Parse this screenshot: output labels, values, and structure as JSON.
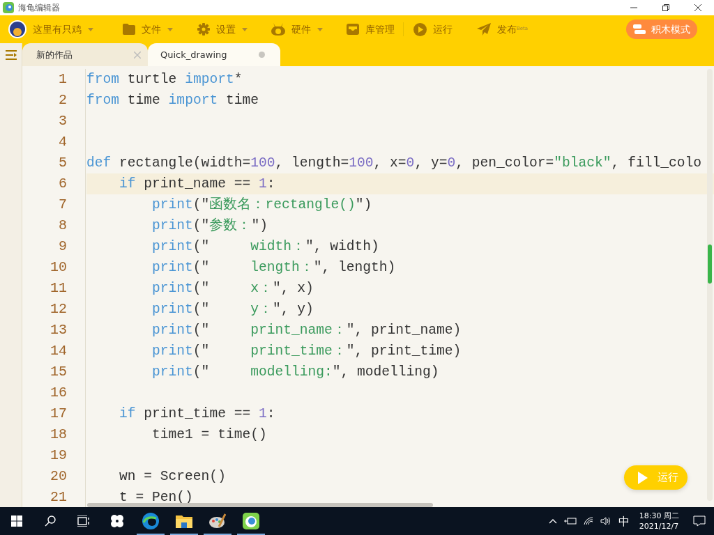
{
  "window": {
    "title": "海龟编辑器"
  },
  "toolbar": {
    "user": "这里有只鸡",
    "menus": [
      {
        "label": "文件",
        "dropdown": true
      },
      {
        "label": "设置",
        "dropdown": true
      },
      {
        "label": "硬件",
        "dropdown": true
      },
      {
        "label": "库管理",
        "dropdown": false
      },
      {
        "label": "运行",
        "dropdown": false
      },
      {
        "label": "发布$^{Beta}$",
        "dropdown": false
      }
    ],
    "mode_button": "积木模式"
  },
  "tabs": [
    {
      "label": "新的作品",
      "selected": false,
      "modified": false
    },
    {
      "label": "Quick_drawing",
      "selected": true,
      "modified": true
    }
  ],
  "editor": {
    "lines": [
      {
        "number": "1",
        "current": false,
        "tokens": [
          {
            "kind": "kw",
            "text": "from"
          },
          {
            "kind": "plain",
            "text": " turtle "
          },
          {
            "kind": "kw",
            "text": "import"
          },
          {
            "kind": "plain",
            "text": "*"
          }
        ]
      },
      {
        "number": "2",
        "current": false,
        "tokens": [
          {
            "kind": "kw",
            "text": "from"
          },
          {
            "kind": "plain",
            "text": " time "
          },
          {
            "kind": "kw",
            "text": "import"
          },
          {
            "kind": "plain",
            "text": " time"
          }
        ]
      },
      {
        "number": "3",
        "current": false
      },
      {
        "number": "4",
        "current": false
      },
      {
        "number": "5",
        "current": false,
        "tokens": [
          {
            "kind": "kw",
            "text": "def"
          },
          {
            "kind": "plain",
            "text": " rectangle(width="
          },
          {
            "kind": "num",
            "text": "100"
          },
          {
            "kind": "plain",
            "text": ", length="
          },
          {
            "kind": "num",
            "text": "100"
          },
          {
            "kind": "plain",
            "text": ", x="
          },
          {
            "kind": "num",
            "text": "0"
          },
          {
            "kind": "plain",
            "text": ", y="
          },
          {
            "kind": "num",
            "text": "0"
          },
          {
            "kind": "plain",
            "text": ", pen_color="
          },
          {
            "kind": "str",
            "text": "\"black\""
          },
          {
            "kind": "plain",
            "text": ", fill_colo"
          }
        ]
      },
      {
        "number": "6",
        "current": true,
        "tokens": [
          {
            "kind": "kw",
            "text": "    if"
          },
          {
            "kind": "plain",
            "text": " print_name == "
          },
          {
            "kind": "num",
            "text": "1"
          },
          {
            "kind": "plain",
            "text": ":"
          }
        ]
      },
      {
        "number": "7",
        "current": false,
        "tokens": [
          {
            "kind": "builtin",
            "text": "        print"
          },
          {
            "kind": "plain",
            "text": "(\""
          },
          {
            "kind": "str",
            "text": "函数名：rectangle()"
          },
          {
            "kind": "plain",
            "text": "\")"
          }
        ]
      },
      {
        "number": "8",
        "current": false,
        "tokens": [
          {
            "kind": "builtin",
            "text": "        print"
          },
          {
            "kind": "plain",
            "text": "(\""
          },
          {
            "kind": "str",
            "text": "参数："
          },
          {
            "kind": "plain",
            "text": "\")"
          }
        ]
      },
      {
        "number": "9",
        "current": false,
        "tokens": [
          {
            "kind": "builtin",
            "text": "        print"
          },
          {
            "kind": "plain",
            "text": "(\"     "
          },
          {
            "kind": "str",
            "text": "width："
          },
          {
            "kind": "plain",
            "text": "\", width)"
          }
        ]
      },
      {
        "number": "10",
        "current": false,
        "tokens": [
          {
            "kind": "builtin",
            "text": "        print"
          },
          {
            "kind": "plain",
            "text": "(\"     "
          },
          {
            "kind": "str",
            "text": "length："
          },
          {
            "kind": "plain",
            "text": "\", length)"
          }
        ]
      },
      {
        "number": "11",
        "current": false,
        "tokens": [
          {
            "kind": "builtin",
            "text": "        print"
          },
          {
            "kind": "plain",
            "text": "(\"     "
          },
          {
            "kind": "str",
            "text": "x："
          },
          {
            "kind": "plain",
            "text": "\", x)"
          }
        ]
      },
      {
        "number": "12",
        "current": false,
        "tokens": [
          {
            "kind": "builtin",
            "text": "        print"
          },
          {
            "kind": "plain",
            "text": "(\"     "
          },
          {
            "kind": "str",
            "text": "y："
          },
          {
            "kind": "plain",
            "text": "\", y)"
          }
        ]
      },
      {
        "number": "13",
        "current": false,
        "tokens": [
          {
            "kind": "builtin",
            "text": "        print"
          },
          {
            "kind": "plain",
            "text": "(\"     "
          },
          {
            "kind": "str",
            "text": "print_name："
          },
          {
            "kind": "plain",
            "text": "\", print_name)"
          }
        ]
      },
      {
        "number": "14",
        "current": false,
        "tokens": [
          {
            "kind": "builtin",
            "text": "        print"
          },
          {
            "kind": "plain",
            "text": "(\"     "
          },
          {
            "kind": "str",
            "text": "print_time："
          },
          {
            "kind": "plain",
            "text": "\", print_time)"
          }
        ]
      },
      {
        "number": "15",
        "current": false,
        "tokens": [
          {
            "kind": "builtin",
            "text": "        print"
          },
          {
            "kind": "plain",
            "text": "(\"     "
          },
          {
            "kind": "str",
            "text": "modelling:"
          },
          {
            "kind": "plain",
            "text": "\", modelling)"
          }
        ]
      },
      {
        "number": "16",
        "current": false
      },
      {
        "number": "17",
        "current": false,
        "tokens": [
          {
            "kind": "kw",
            "text": "    if"
          },
          {
            "kind": "plain",
            "text": " print_time == "
          },
          {
            "kind": "num",
            "text": "1"
          },
          {
            "kind": "plain",
            "text": ":"
          }
        ]
      },
      {
        "number": "18",
        "current": false,
        "tokens": [
          {
            "kind": "plain",
            "text": "        time1 = time()"
          }
        ]
      },
      {
        "number": "19",
        "current": false
      },
      {
        "number": "20",
        "current": false,
        "tokens": [
          {
            "kind": "plain",
            "text": "    wn = Screen()"
          }
        ]
      },
      {
        "number": "21",
        "current": false,
        "tokens": [
          {
            "kind": "plain",
            "text": "    t = Pen()"
          }
        ]
      }
    ]
  },
  "run_button": {
    "label": "运行"
  },
  "taskbar": {
    "apps": [
      {
        "open": false
      },
      {
        "open": true
      },
      {
        "open": true
      },
      {
        "open": true
      },
      {
        "open": true
      }
    ],
    "ime": "中",
    "time": "18:30 周二",
    "date": "2021/12/7"
  }
}
